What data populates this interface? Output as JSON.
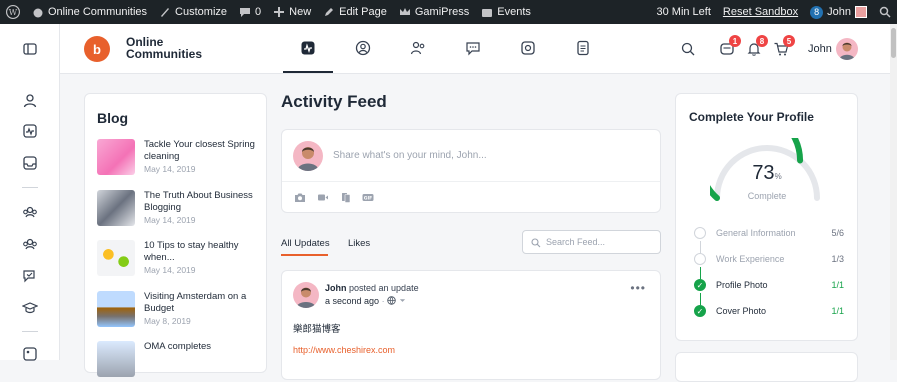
{
  "adminbar": {
    "site_name": "Online Communities",
    "customize": "Customize",
    "comments_count": "0",
    "new": "New",
    "edit_page": "Edit Page",
    "gamipress": "GamiPress",
    "events": "Events",
    "timer": "30 Min Left",
    "reset": "Reset Sandbox",
    "user_badge": "8",
    "user": "John"
  },
  "header": {
    "logo_line1": "Online",
    "logo_line2": "Communities",
    "notif_messages": "1",
    "notif_bell": "8",
    "notif_cart": "5",
    "user": "John"
  },
  "blog": {
    "title": "Blog",
    "items": [
      {
        "title": "Tackle Your closest Spring cleaning",
        "date": "May 14, 2019"
      },
      {
        "title": "The Truth About Business Blogging",
        "date": "May 14, 2019"
      },
      {
        "title": "10 Tips to stay healthy when...",
        "date": "May 14, 2019"
      },
      {
        "title": "Visiting Amsterdam on a Budget",
        "date": "May 8, 2019"
      },
      {
        "title": "OMA completes",
        "date": ""
      }
    ]
  },
  "feed": {
    "title": "Activity Feed",
    "composer_placeholder": "Share what's on your mind, John...",
    "tabs": [
      "All Updates",
      "Likes"
    ],
    "search_placeholder": "Search Feed...",
    "post": {
      "author": "John",
      "action": "posted an update",
      "time": "a second ago",
      "text": "樂郎猫博客",
      "link": "http://www.cheshirex.com"
    }
  },
  "profile": {
    "title": "Complete Your Profile",
    "percent": "73",
    "percent_unit": "%",
    "percent_value": 0.73,
    "label": "Complete",
    "steps": [
      {
        "label": "General Information",
        "count": "5/6",
        "done": false
      },
      {
        "label": "Work Experience",
        "count": "1/3",
        "done": false
      },
      {
        "label": "Profile Photo",
        "count": "1/1",
        "done": true
      },
      {
        "label": "Cover Photo",
        "count": "1/1",
        "done": true
      }
    ]
  },
  "colors": {
    "accent": "#e8602c",
    "success": "#16a34a",
    "adminbar": "#1d2327"
  }
}
